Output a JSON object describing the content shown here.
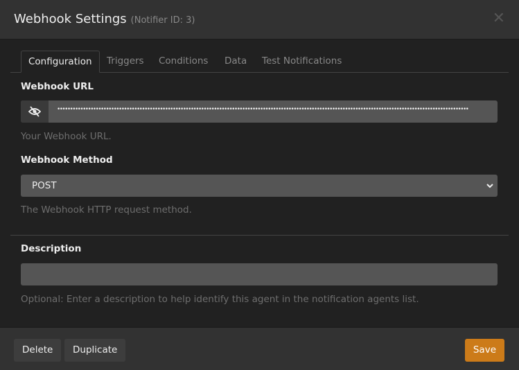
{
  "dialog": {
    "title": "Webhook Settings",
    "subtitle": "(Notifier ID: 3)",
    "close_icon": "close-icon"
  },
  "tabs": [
    {
      "label": "Configuration",
      "active": true
    },
    {
      "label": "Triggers"
    },
    {
      "label": "Conditions"
    },
    {
      "label": "Data"
    },
    {
      "label": "Test Notifications"
    }
  ],
  "webhook_url": {
    "label": "Webhook URL",
    "value_masked": "••••••••••••••••••••••••••••••••••••••••••••••••••••••••••••••••••••••••••••••••••••••••••••••••••••••••••••••••••••••••••••••••••••••••••••••••••••••••••••••••",
    "help": "Your Webhook URL.",
    "toggle_icon": "eye-slash-icon"
  },
  "webhook_method": {
    "label": "Webhook Method",
    "value": "POST",
    "help": "The Webhook HTTP request method."
  },
  "description": {
    "label": "Description",
    "value": "",
    "help": "Optional: Enter a description to help identify this agent in the notification agents list."
  },
  "footer": {
    "delete": "Delete",
    "duplicate": "Duplicate",
    "save": "Save"
  },
  "colors": {
    "save": "#cc7b19",
    "background": "#212121",
    "header": "#323232",
    "input": "#555555"
  }
}
